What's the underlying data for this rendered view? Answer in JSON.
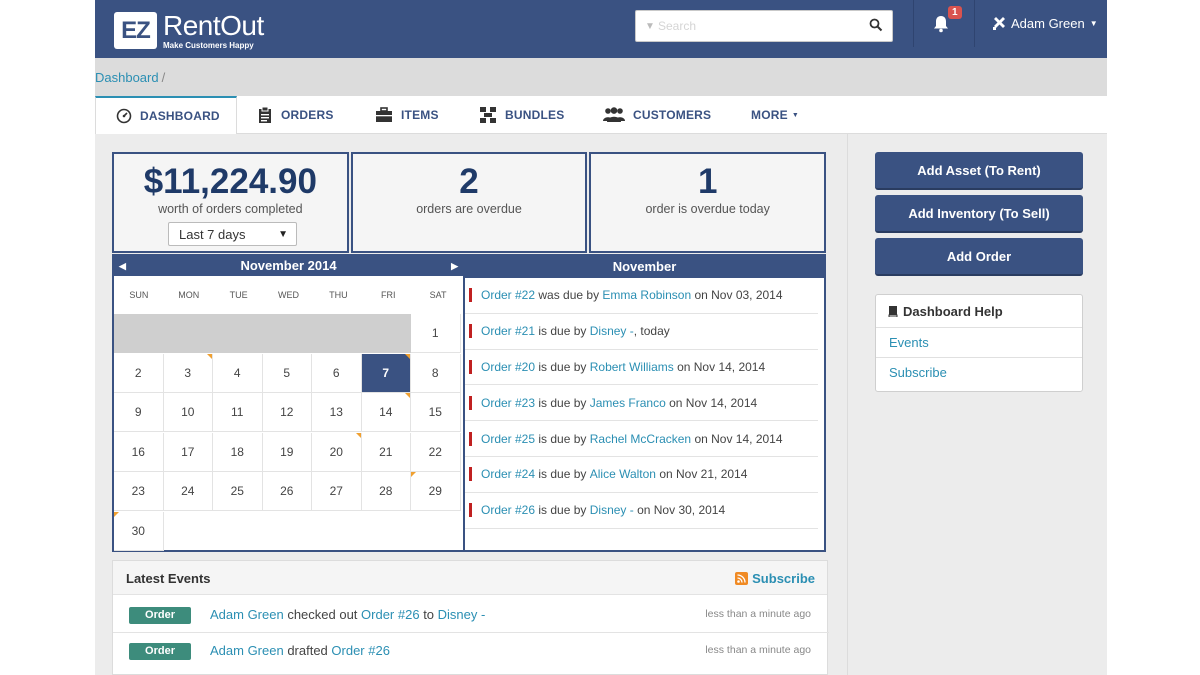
{
  "brand": {
    "logo_mark": "EZ",
    "name": "RentOut",
    "tagline": "Make Customers Happy"
  },
  "search": {
    "placeholder": "Search"
  },
  "notifications": {
    "count": "1"
  },
  "user": {
    "name": "Adam Green"
  },
  "breadcrumb": {
    "item": "Dashboard",
    "sep": "/"
  },
  "tabs": [
    {
      "label": "DASHBOARD",
      "icon": "dashboard-icon"
    },
    {
      "label": "ORDERS",
      "icon": "clipboard-icon"
    },
    {
      "label": "ITEMS",
      "icon": "briefcase-icon"
    },
    {
      "label": "BUNDLES",
      "icon": "bundles-icon"
    },
    {
      "label": "CUSTOMERS",
      "icon": "users-icon"
    },
    {
      "label": "MORE",
      "icon": "caret-down-icon"
    }
  ],
  "stats": {
    "revenue": {
      "value": "$11,224.90",
      "label": "worth of orders completed",
      "period": "Last 7 days"
    },
    "overdue": {
      "value": "2",
      "label": "orders are overdue"
    },
    "overdue_today": {
      "value": "1",
      "label": "order is overdue today"
    }
  },
  "calendar": {
    "month": "November 2014",
    "days_of_week": [
      "SUN",
      "MON",
      "TUE",
      "WED",
      "THU",
      "FRI",
      "SAT"
    ],
    "today": "7"
  },
  "events_panel": {
    "title": "November",
    "items": [
      {
        "order": "Order #22",
        "verb": " was due by ",
        "customer": "Emma Robinson",
        "date": " on Nov 03, 2014"
      },
      {
        "order": "Order #21",
        "verb": " is due by ",
        "customer": "Disney -",
        "date": ", today"
      },
      {
        "order": "Order #20",
        "verb": " is due by ",
        "customer": "Robert Williams",
        "date": " on Nov 14, 2014"
      },
      {
        "order": "Order #23",
        "verb": " is due by ",
        "customer": "James Franco",
        "date": " on Nov 14, 2014"
      },
      {
        "order": "Order #25",
        "verb": " is due by ",
        "customer": "Rachel McCracken",
        "date": " on Nov 14, 2014"
      },
      {
        "order": "Order #24",
        "verb": " is due by ",
        "customer": "Alice Walton",
        "date": " on Nov 21, 2014"
      },
      {
        "order": "Order #26",
        "verb": " is due by ",
        "customer": "Disney -",
        "date": " on Nov 30, 2014"
      }
    ]
  },
  "latest_events": {
    "title": "Latest Events",
    "subscribe": "Subscribe",
    "rows": [
      {
        "tag": "Order",
        "actor": "Adam Green",
        "action": " checked out ",
        "order": "Order #26",
        "mid": " to ",
        "target": "Disney -",
        "time": "less than a minute ago"
      },
      {
        "tag": "Order",
        "actor": "Adam Green",
        "action": " drafted ",
        "order": "Order #26",
        "mid": "",
        "target": "",
        "time": "less than a minute ago"
      }
    ]
  },
  "actions": {
    "add_asset": "Add Asset (To Rent)",
    "add_inventory": "Add Inventory (To Sell)",
    "add_order": "Add Order"
  },
  "help": {
    "title": "Dashboard Help",
    "items": [
      "Events",
      "Subscribe"
    ]
  }
}
